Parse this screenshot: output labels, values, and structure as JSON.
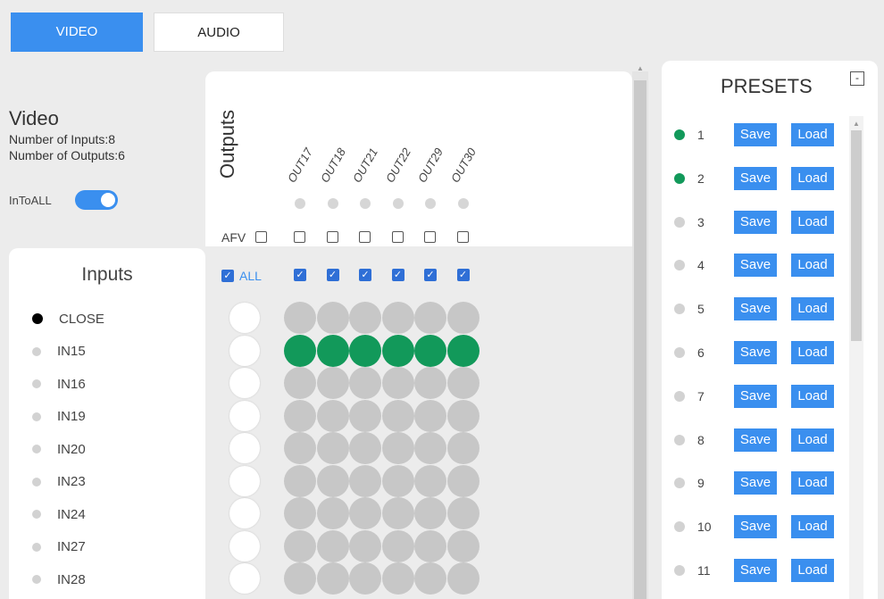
{
  "tabs": [
    {
      "label": "VIDEO",
      "active": true
    },
    {
      "label": "AUDIO",
      "active": false
    }
  ],
  "info": {
    "title": "Video",
    "inputs_line": "Number of Inputs:8",
    "outputs_line": "Number of Outputs:6"
  },
  "intoall": {
    "label": "InToALL",
    "on": true
  },
  "inputs": {
    "title": "Inputs",
    "items": [
      "CLOSE",
      "IN15",
      "IN16",
      "IN19",
      "IN20",
      "IN23",
      "IN24",
      "IN27",
      "IN28"
    ]
  },
  "outputs": {
    "title": "Outputs",
    "labels": [
      "OUT17",
      "OUT18",
      "OUT21",
      "OUT22",
      "OUT29",
      "OUT30"
    ],
    "afv_label": "AFV",
    "all_label": "ALL",
    "check_mark": "✓"
  },
  "matrix": {
    "rows": 9,
    "cols": 6,
    "active_row": 1
  },
  "presets": {
    "title": "PRESETS",
    "collapse_symbol": "-",
    "save_label": "Save",
    "load_label": "Load",
    "items": [
      {
        "num": "1",
        "on": true
      },
      {
        "num": "2",
        "on": true
      },
      {
        "num": "3",
        "on": false
      },
      {
        "num": "4",
        "on": false
      },
      {
        "num": "5",
        "on": false
      },
      {
        "num": "6",
        "on": false
      },
      {
        "num": "7",
        "on": false
      },
      {
        "num": "8",
        "on": false
      },
      {
        "num": "9",
        "on": false
      },
      {
        "num": "10",
        "on": false
      },
      {
        "num": "11",
        "on": false
      }
    ]
  },
  "colors": {
    "accent": "#3a8fef",
    "route_on": "#12995a",
    "route_off": "#c7c7c7",
    "checkbox": "#2f6fd6"
  },
  "icons": {
    "scroll_up": "▲"
  }
}
